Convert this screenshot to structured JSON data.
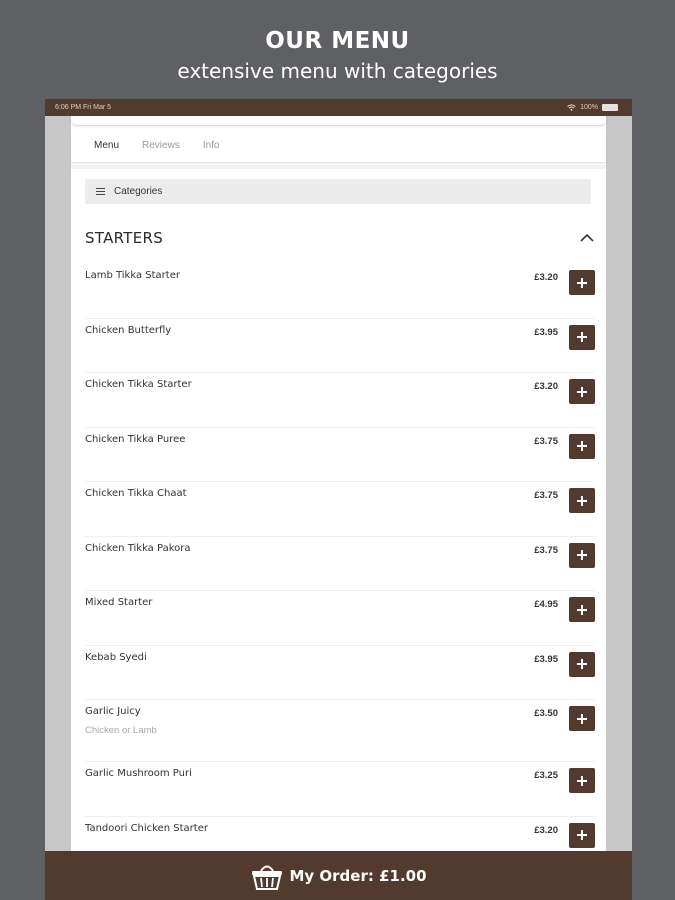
{
  "promo": {
    "title": "OUR MENU",
    "subtitle": "extensive menu with categories"
  },
  "status_bar": {
    "time": "6:06 PM Fri Mar 5",
    "battery": "100%"
  },
  "tabs": [
    {
      "label": "Menu",
      "active": true
    },
    {
      "label": "Reviews",
      "active": false
    },
    {
      "label": "Info",
      "active": false
    }
  ],
  "categories": {
    "label": "Categories",
    "icon": "hamburger-icon"
  },
  "section": {
    "title": "STARTERS",
    "icon": "chevron-up-icon"
  },
  "menu_items": [
    {
      "name": "Lamb Tikka Starter",
      "price": "£3.20",
      "description": ""
    },
    {
      "name": "Chicken Butterfly",
      "price": "£3.95",
      "description": ""
    },
    {
      "name": "Chicken Tikka Starter",
      "price": "£3.20",
      "description": ""
    },
    {
      "name": "Chicken Tikka Puree",
      "price": "£3.75",
      "description": ""
    },
    {
      "name": "Chicken Tikka Chaat",
      "price": "£3.75",
      "description": ""
    },
    {
      "name": "Chicken Tikka Pakora",
      "price": "£3.75",
      "description": ""
    },
    {
      "name": "Mixed Starter",
      "price": "£4.95",
      "description": ""
    },
    {
      "name": "Kebab Syedi",
      "price": "£3.95",
      "description": ""
    },
    {
      "name": "Garlic Juicy",
      "price": "£3.50",
      "description": "Chicken or Lamb"
    },
    {
      "name": "Garlic Mushroom Puri",
      "price": "£3.25",
      "description": ""
    },
    {
      "name": "Tandoori Chicken Starter",
      "price": "£3.20",
      "description": ""
    }
  ],
  "order_bar": {
    "label": "My Order: £1.00",
    "icon": "basket-icon"
  },
  "colors": {
    "brand_brown": "#523a2e",
    "background_gray": "#5f6064"
  }
}
